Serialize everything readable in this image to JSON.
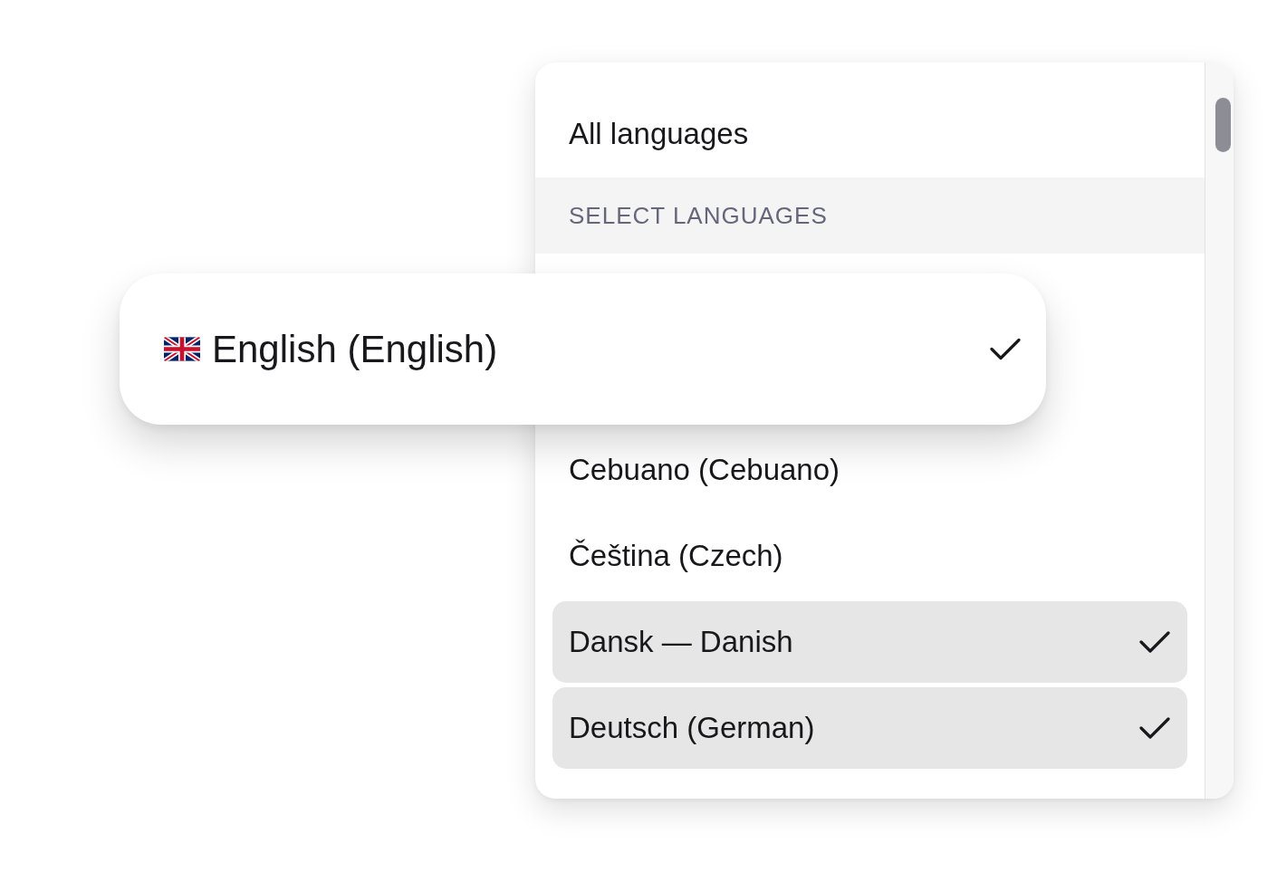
{
  "dropdown": {
    "all_option": {
      "label": "All languages",
      "selected": false
    },
    "section_header": "SELECT LANGUAGES",
    "options": [
      {
        "label": "Cebuano (Cebuano)",
        "selected": false
      },
      {
        "label": "Čeština (Czech)",
        "selected": false
      },
      {
        "label": "Dansk — Danish",
        "selected": true
      },
      {
        "label": "Deutsch (German)",
        "selected": true
      }
    ]
  },
  "zoomed_option": {
    "label": "English (English)",
    "selected": true
  }
}
